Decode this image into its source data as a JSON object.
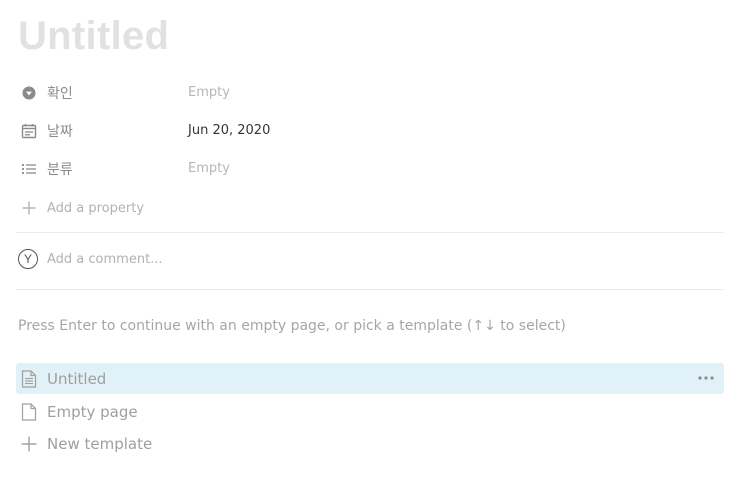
{
  "page": {
    "title": "Untitled"
  },
  "properties": [
    {
      "name": "확인",
      "value": "Empty",
      "icon": "select-circle-icon",
      "empty": true
    },
    {
      "name": "날짜",
      "value": "Jun 20, 2020",
      "icon": "calendar-icon",
      "empty": false
    },
    {
      "name": "분류",
      "value": "Empty",
      "icon": "list-icon",
      "empty": true
    }
  ],
  "add_property": {
    "label": "Add a property",
    "icon": "plus-icon"
  },
  "comment": {
    "avatar_letter": "Y",
    "placeholder": "Add a comment..."
  },
  "template_picker": {
    "hint": "Press Enter to continue with an empty page, or pick a template (↑↓ to select)",
    "items": [
      {
        "label": "Untitled",
        "icon": "page-text-icon",
        "selected": true
      },
      {
        "label": "Empty page",
        "icon": "page-icon",
        "selected": false
      },
      {
        "label": "New template",
        "icon": "plus-icon",
        "selected": false
      }
    ]
  },
  "colors": {
    "selected_bg": "#e1f1f8",
    "title_placeholder": "#e1e1e0",
    "text": "#37352f"
  }
}
